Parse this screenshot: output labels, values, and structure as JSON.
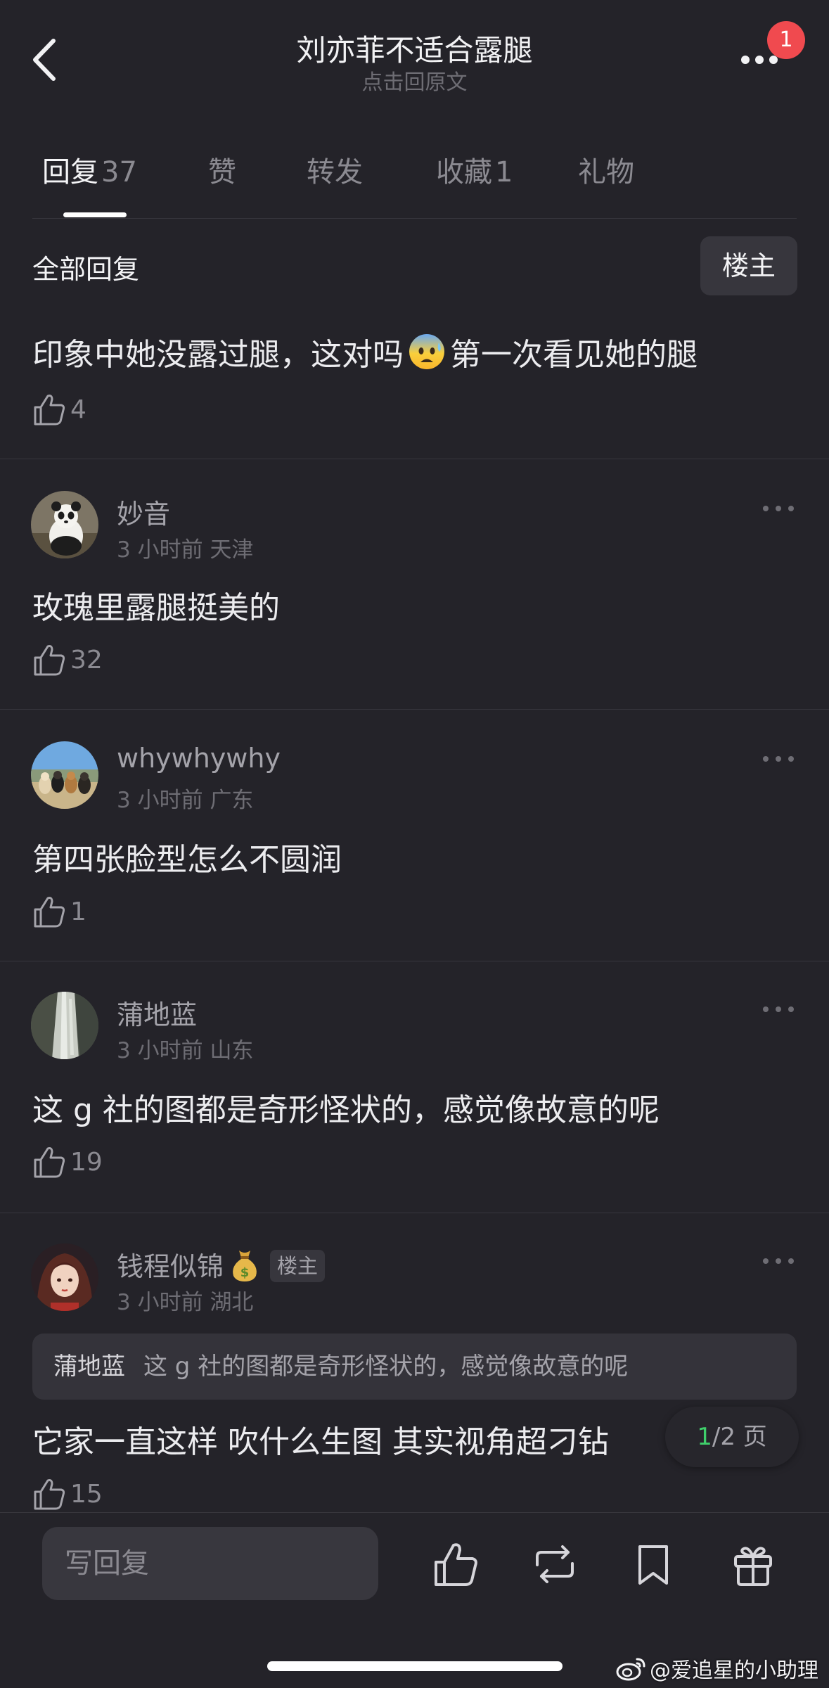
{
  "header": {
    "title": "刘亦菲不适合露腿",
    "subtitle": "点击回原文",
    "notification_count": "1"
  },
  "tabs": [
    {
      "label": "回复",
      "count": "37",
      "active": true
    },
    {
      "label": "赞",
      "count": ""
    },
    {
      "label": "转发",
      "count": ""
    },
    {
      "label": "收藏",
      "count": "1"
    },
    {
      "label": "礼物",
      "count": ""
    }
  ],
  "filter": {
    "all_label": "全部回复",
    "op_label": "楼主"
  },
  "post": {
    "text_before": "印象中她没露过腿，这对吗",
    "emoji": "fearful-face-emoji",
    "text_after": "第一次看见她的腿",
    "likes": "4"
  },
  "comments": [
    {
      "name": "妙音",
      "time": "3 小时前",
      "location": "天津",
      "text": "玫瑰里露腿挺美的",
      "likes": "32",
      "avatar": "panda-avatar"
    },
    {
      "name": "whywhywhy",
      "time": "3 小时前",
      "location": "广东",
      "text": "第四张脸型怎么不圆润",
      "likes": "1",
      "avatar": "dogs-avatar"
    },
    {
      "name": "蒲地蓝",
      "time": "3 小时前",
      "location": "山东",
      "text": "这 g 社的图都是奇形怪状的，感觉像故意的呢",
      "likes": "19",
      "avatar": "waterfall-avatar"
    },
    {
      "name": "钱程似锦",
      "name_emoji": "money-bag-emoji",
      "tag": "楼主",
      "time": "3 小时前",
      "location": "湖北",
      "quote_name": "蒲地蓝",
      "quote_text": "这 g 社的图都是奇形怪状的，感觉像故意的呢",
      "text": "它家一直这样 吹什么生图 其实视角超刁钻",
      "likes": "15",
      "avatar": "anime-girl-avatar"
    }
  ],
  "pagination": {
    "current": "1",
    "total_text": "/2 页"
  },
  "bottom_bar": {
    "reply_placeholder": "写回复",
    "icons": [
      "like-icon",
      "repost-icon",
      "bookmark-icon",
      "gift-icon"
    ]
  },
  "watermark": "@爱追星的小助理",
  "colors": {
    "background": "#242329",
    "badge": "#f04a4f",
    "page_current": "#3fcf6b",
    "surface": "#37363d"
  }
}
